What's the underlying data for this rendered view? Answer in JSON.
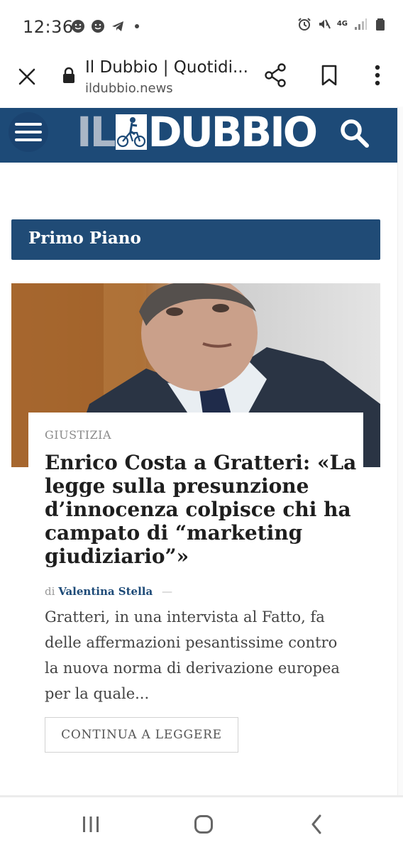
{
  "status_bar": {
    "time": "12:36",
    "network": "4G"
  },
  "browser": {
    "title": "Il Dubbio | Quotidi...",
    "url": "ildubbio.news"
  },
  "site": {
    "logo_il": "IL",
    "logo_dubbio": "DUBBIO",
    "brand_color": "#1d4a77"
  },
  "section": {
    "heading": "Primo Piano"
  },
  "article": {
    "category": "GIUSTIZIA",
    "title": "Enrico Costa a Gratteri: «La legge sulla presunzione d’innocenza colpisce chi ha campato di “marketing giudiziario”»",
    "byline_prefix": "di",
    "author": "Valentina Stella",
    "byline_suffix": "—",
    "excerpt": "Gratteri, in una intervista al Fatto, fa delle affermazioni pesantissime contro la nuova norma di derivazione europea per la quale...",
    "read_more_label": "CONTINUA A LEGGERE"
  }
}
